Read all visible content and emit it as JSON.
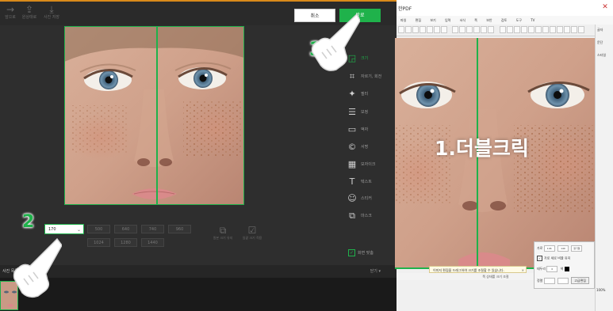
{
  "editor": {
    "tools": [
      {
        "icon": "arrow-right-icon",
        "glyph": "→",
        "label": "앞으로"
      },
      {
        "icon": "share-icon",
        "glyph": "⇪",
        "label": "원상태로"
      },
      {
        "icon": "download-icon",
        "glyph": "⤓",
        "label": "사진 저장"
      }
    ],
    "cancel_label": "취소",
    "done_label": "완료",
    "menu": [
      {
        "icon": "resize-icon",
        "glyph": "◲",
        "label": "크기",
        "active": true
      },
      {
        "icon": "crop-icon",
        "glyph": "⌗",
        "label": "자르기, 회전"
      },
      {
        "icon": "magic-wand-icon",
        "glyph": "✦",
        "label": "필터"
      },
      {
        "icon": "adjust-icon",
        "glyph": "☰",
        "label": "보정"
      },
      {
        "icon": "frame-icon",
        "glyph": "▭",
        "label": "액자"
      },
      {
        "icon": "copyright-icon",
        "glyph": "©",
        "label": "서명"
      },
      {
        "icon": "mosaic-icon",
        "glyph": "▦",
        "label": "모자이크"
      },
      {
        "icon": "text-icon",
        "glyph": "T",
        "label": "텍스트"
      },
      {
        "icon": "sticker-icon",
        "glyph": "☺",
        "label": "스티커"
      },
      {
        "icon": "layers-icon",
        "glyph": "⧉",
        "label": "마스크"
      }
    ],
    "size_value": "170",
    "presets_row1": [
      "500",
      "640",
      "740",
      "960"
    ],
    "presets_row2": [
      "1024",
      "1280",
      "1440"
    ],
    "options": [
      {
        "icon": "copy-icon",
        "glyph": "⧉",
        "label": "원본 크기 유지"
      },
      {
        "icon": "checkbox-icon",
        "glyph": "☑",
        "label": "일괄 크기 적용"
      }
    ],
    "fit_label": "화면 맞춤",
    "filmstrip_title": "사진 목록",
    "filmstrip_more": "닫기 ▾"
  },
  "annotations": {
    "step2": "2",
    "step3": "3",
    "double_click": "1.더블크릭"
  },
  "document": {
    "title": "한PDF",
    "menu_items": [
      "파일",
      "편집",
      "보기",
      "입력",
      "서식",
      "쪽",
      "보안",
      "검토",
      "도구",
      "TV"
    ],
    "tooltip": "이미지 편집을 드래그하여 크기를 조절할 수 있습니다.",
    "status": "쪽 상태를 크기 조절",
    "sidebar_labels": [
      "글자",
      "문단",
      "스타일"
    ],
    "props": {
      "row1_label": "가로",
      "row1_values": [
        "146",
        "140",
        "정기형"
      ],
      "keep_ratio": "가로 세로 비율 유지",
      "row3_label": "테두리",
      "row3_value": "0",
      "row3_color": "색",
      "row4_label": "정렬",
      "apply_label": "고급편집"
    },
    "zoom": "100%"
  },
  "colors": {
    "accent": "#1fb24b",
    "toolbar_bg": "#2a2a2a",
    "panel_bg": "#2e2e2e"
  }
}
